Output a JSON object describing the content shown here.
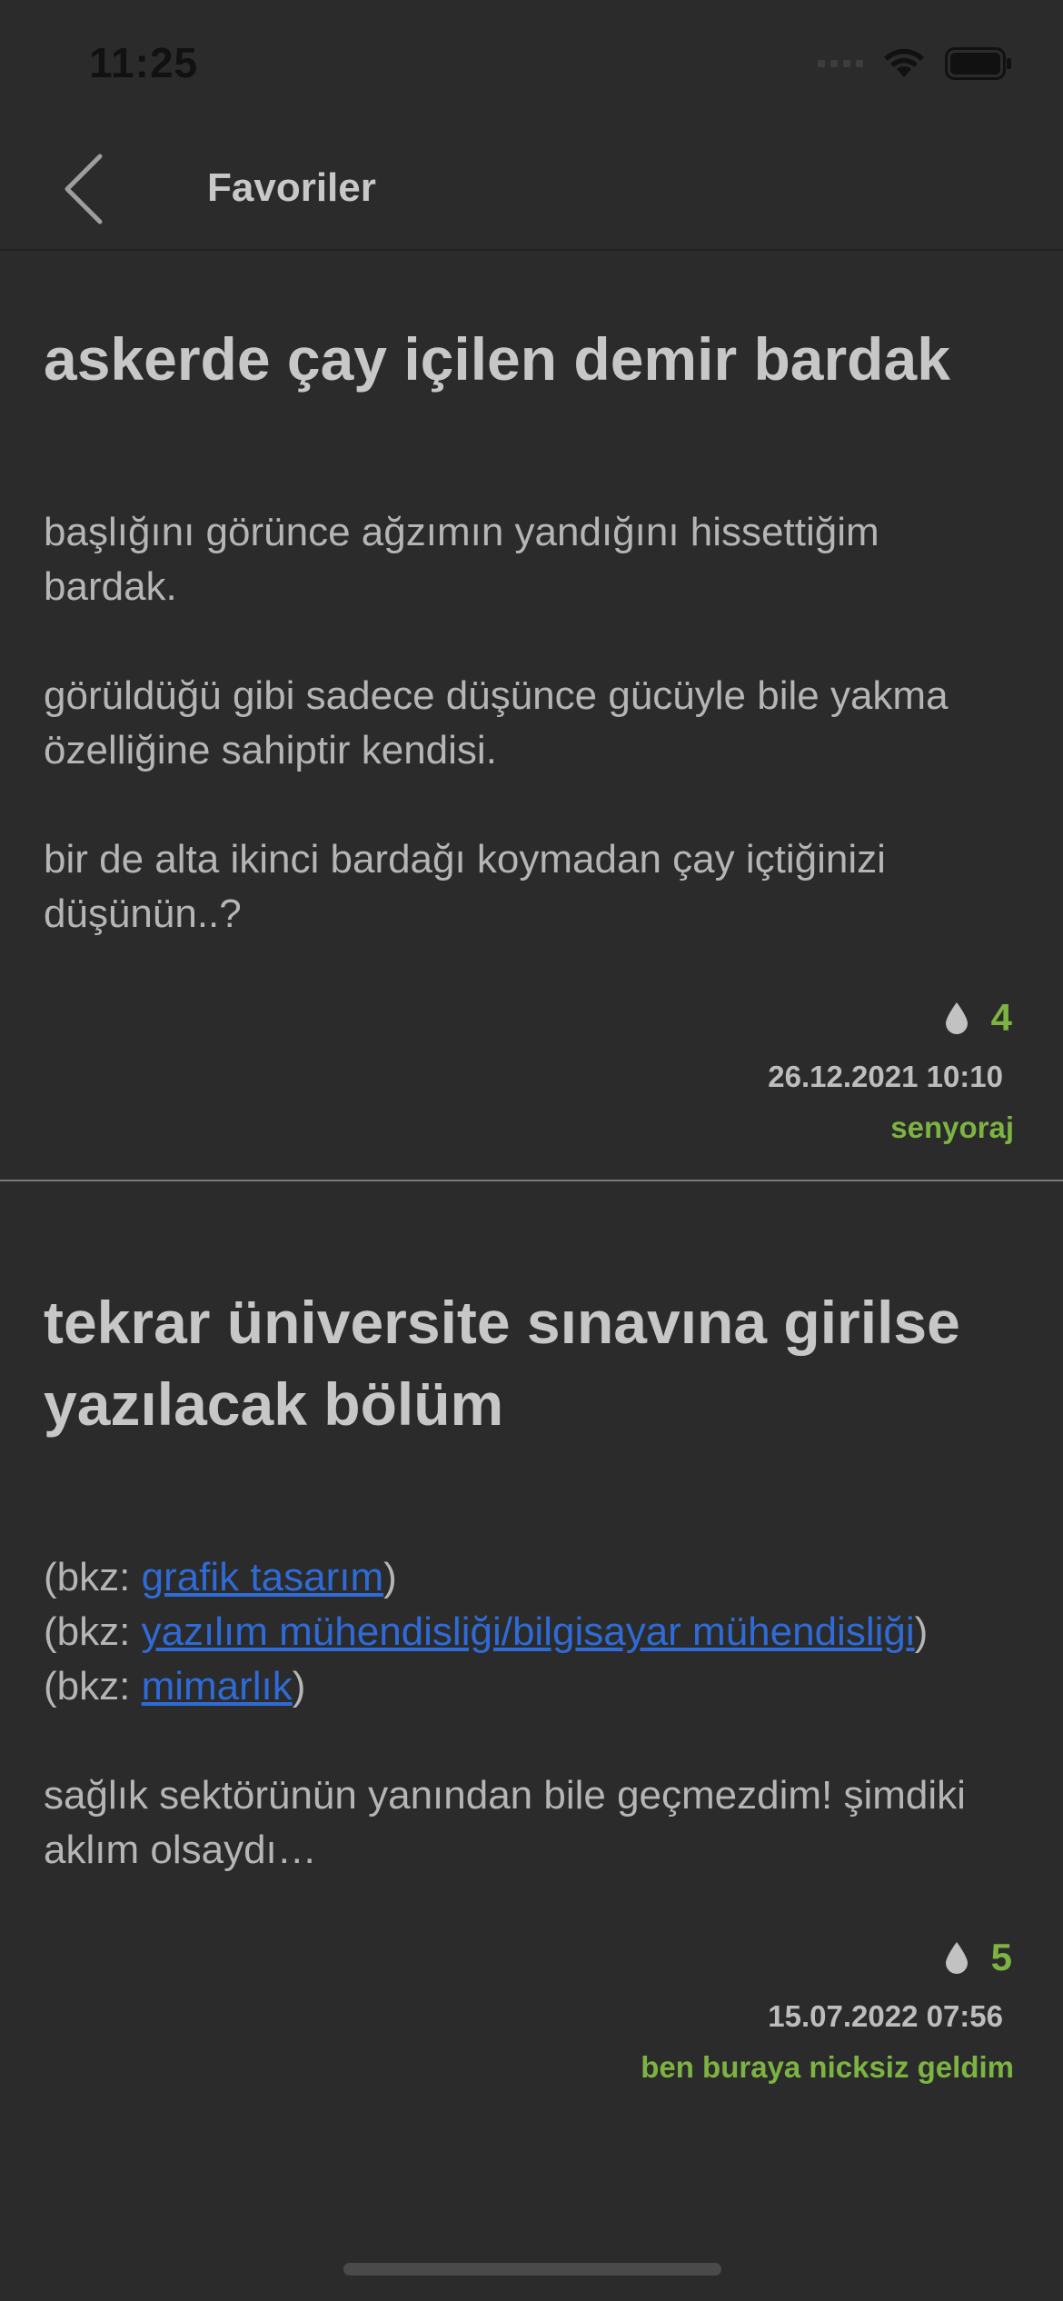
{
  "status_bar": {
    "time": "11:25"
  },
  "nav": {
    "title": "Favoriler"
  },
  "entries": [
    {
      "title": "askerde çay içilen demir bardak",
      "paragraphs": [
        "başlığını görünce ağzımın yandığını hissettiğim bardak.",
        "görüldüğü gibi sadece düşünce gücüyle bile yakma özelliğine sahiptir kendisi.",
        "bir de alta ikinci bardağı koymadan çay içtiğinizi düşünün..?"
      ],
      "favorite_count": "4",
      "date": "26.12.2021 10:10",
      "author": "senyoraj"
    },
    {
      "title": "tekrar üniversite sınavına girilse yazılacak bölüm",
      "bkz_prefix": "(bkz: ",
      "bkz_suffix": ")",
      "bkz_links": [
        "grafik tasarım",
        "yazılım mühendisliği/bilgisayar mühendisliği",
        "mimarlık"
      ],
      "paragraphs": [
        "sağlık sektörünün yanından bile geçmezdim! şimdiki aklım olsaydı…"
      ],
      "favorite_count": "5",
      "date": "15.07.2022 07:56",
      "author": "ben buraya nicksiz geldim"
    }
  ],
  "colors": {
    "background": "#2b2b2b",
    "accent_green": "#7cb342",
    "link_blue": "#2f6bd6"
  },
  "icons": {
    "back": "chevron-left-icon",
    "favorite": "drop-icon",
    "wifi": "wifi-icon",
    "battery": "battery-icon"
  }
}
